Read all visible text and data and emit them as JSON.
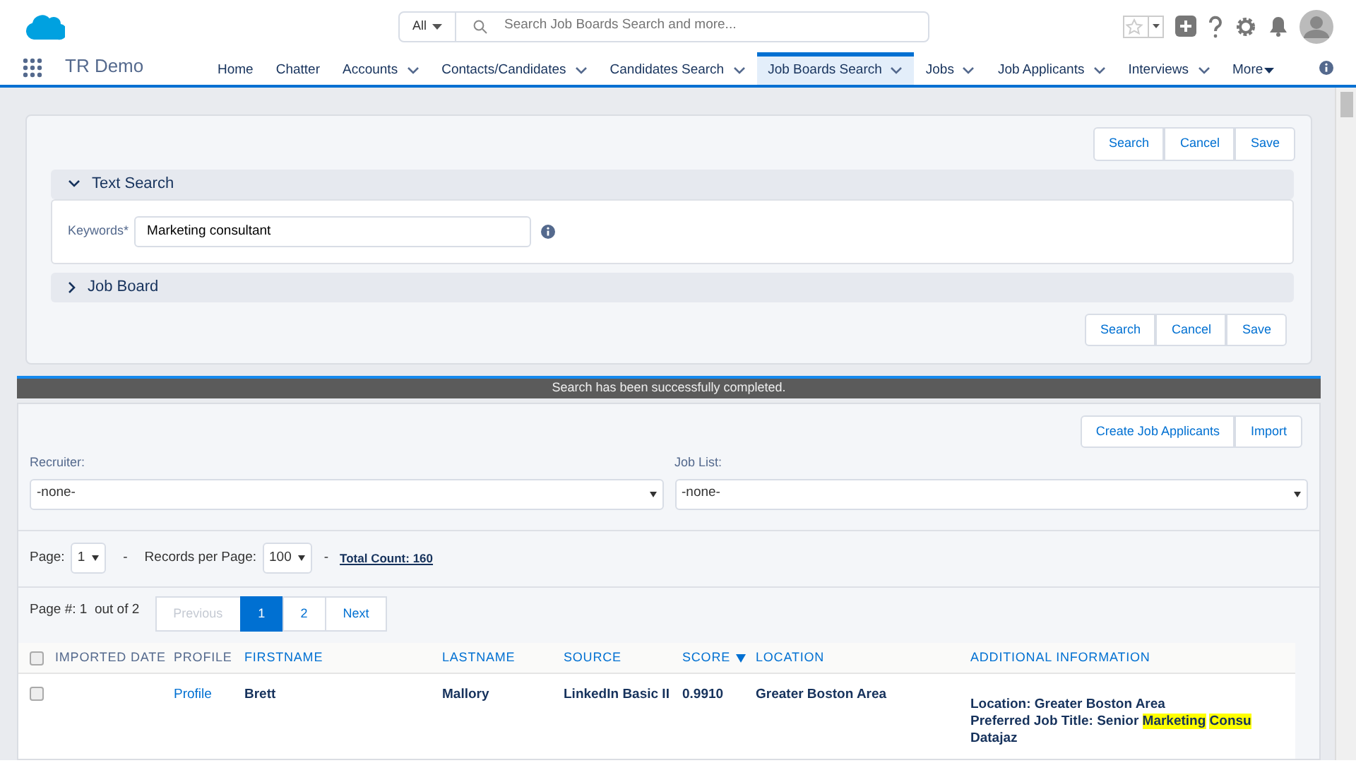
{
  "header": {
    "search_scope": "All",
    "search": {
      "placeholder": "Search Job Boards Search and more..."
    }
  },
  "app_name": "TR Demo",
  "nav_tabs": [
    {
      "label": "Home",
      "dropdown": false,
      "selected": false
    },
    {
      "label": "Chatter",
      "dropdown": false,
      "selected": false
    },
    {
      "label": "Accounts",
      "dropdown": true,
      "selected": false
    },
    {
      "label": "Contacts/Candidates",
      "dropdown": true,
      "selected": false
    },
    {
      "label": "Candidates Search",
      "dropdown": true,
      "selected": false
    },
    {
      "label": "Job Boards Search",
      "dropdown": true,
      "selected": true
    },
    {
      "label": "Jobs",
      "dropdown": true,
      "selected": false
    },
    {
      "label": "Job Applicants",
      "dropdown": true,
      "selected": false
    },
    {
      "label": "Interviews",
      "dropdown": true,
      "selected": false
    },
    {
      "label": "More",
      "dropdown": false,
      "selected": false
    }
  ],
  "top_buttons": [
    "Search",
    "Cancel",
    "Save"
  ],
  "sections": [
    {
      "title": "Text Search",
      "expanded": true,
      "field": {
        "label": "Keywords*",
        "value": "Marketing consultant"
      }
    },
    {
      "title": "Job Board",
      "expanded": false
    }
  ],
  "bottom_buttons": [
    "Search",
    "Cancel",
    "Save"
  ],
  "status_message": "Search has been successfully completed.",
  "result_buttons": [
    "Create Job Applicants",
    "Import"
  ],
  "recruiter": {
    "label": "Recruiter:",
    "value": "-none-"
  },
  "job_list": {
    "label": "Job List:",
    "value": "-none-"
  },
  "paging": {
    "page_label": "Page:",
    "page": "1",
    "sep_1": "-",
    "records_label": "Records per Page:",
    "records": "100",
    "sep_2": "-",
    "total": "Total Count: 160",
    "page_info": "Page #: 1  out of 2"
  },
  "pagination": [
    {
      "label": "Previous",
      "kind": "disabled",
      "selected": false
    },
    {
      "label": "1",
      "kind": "page",
      "selected": true
    },
    {
      "label": "2",
      "kind": "page",
      "selected": false
    },
    {
      "label": "Next",
      "kind": "link",
      "selected": false
    }
  ],
  "table": {
    "columns": [
      {
        "label": "IMPORTED DATE",
        "sortable": false
      },
      {
        "label": "PROFILE",
        "sortable": false
      },
      {
        "label": "FIRSTNAME",
        "sortable": true
      },
      {
        "label": "LASTNAME",
        "sortable": true
      },
      {
        "label": "SOURCE",
        "sortable": true
      },
      {
        "label": "SCORE",
        "sortable": true,
        "sorted": true
      },
      {
        "label": "LOCATION",
        "sortable": true
      },
      {
        "label": "ADDITIONAL INFORMATION",
        "sortable": true
      }
    ],
    "header_checked": false,
    "rows": [
      {
        "checked": false,
        "profile": "Profile",
        "firstname": "Brett",
        "lastname": "Mallory",
        "source": "LinkedIn Basic II",
        "score": "0.9910",
        "location": "Greater Boston Area",
        "additional_information": [
          [
            {
              "text": "Location: Greater Boston Area",
              "highlight": false
            }
          ],
          [
            {
              "text": "Preferred Job Title: Senior",
              "highlight": false
            },
            {
              "text": "Marketing",
              "highlight": true
            },
            {
              "text": "Consu",
              "highlight": true
            }
          ],
          [
            {
              "text": "Datajaz",
              "highlight": false
            }
          ]
        ]
      }
    ]
  }
}
